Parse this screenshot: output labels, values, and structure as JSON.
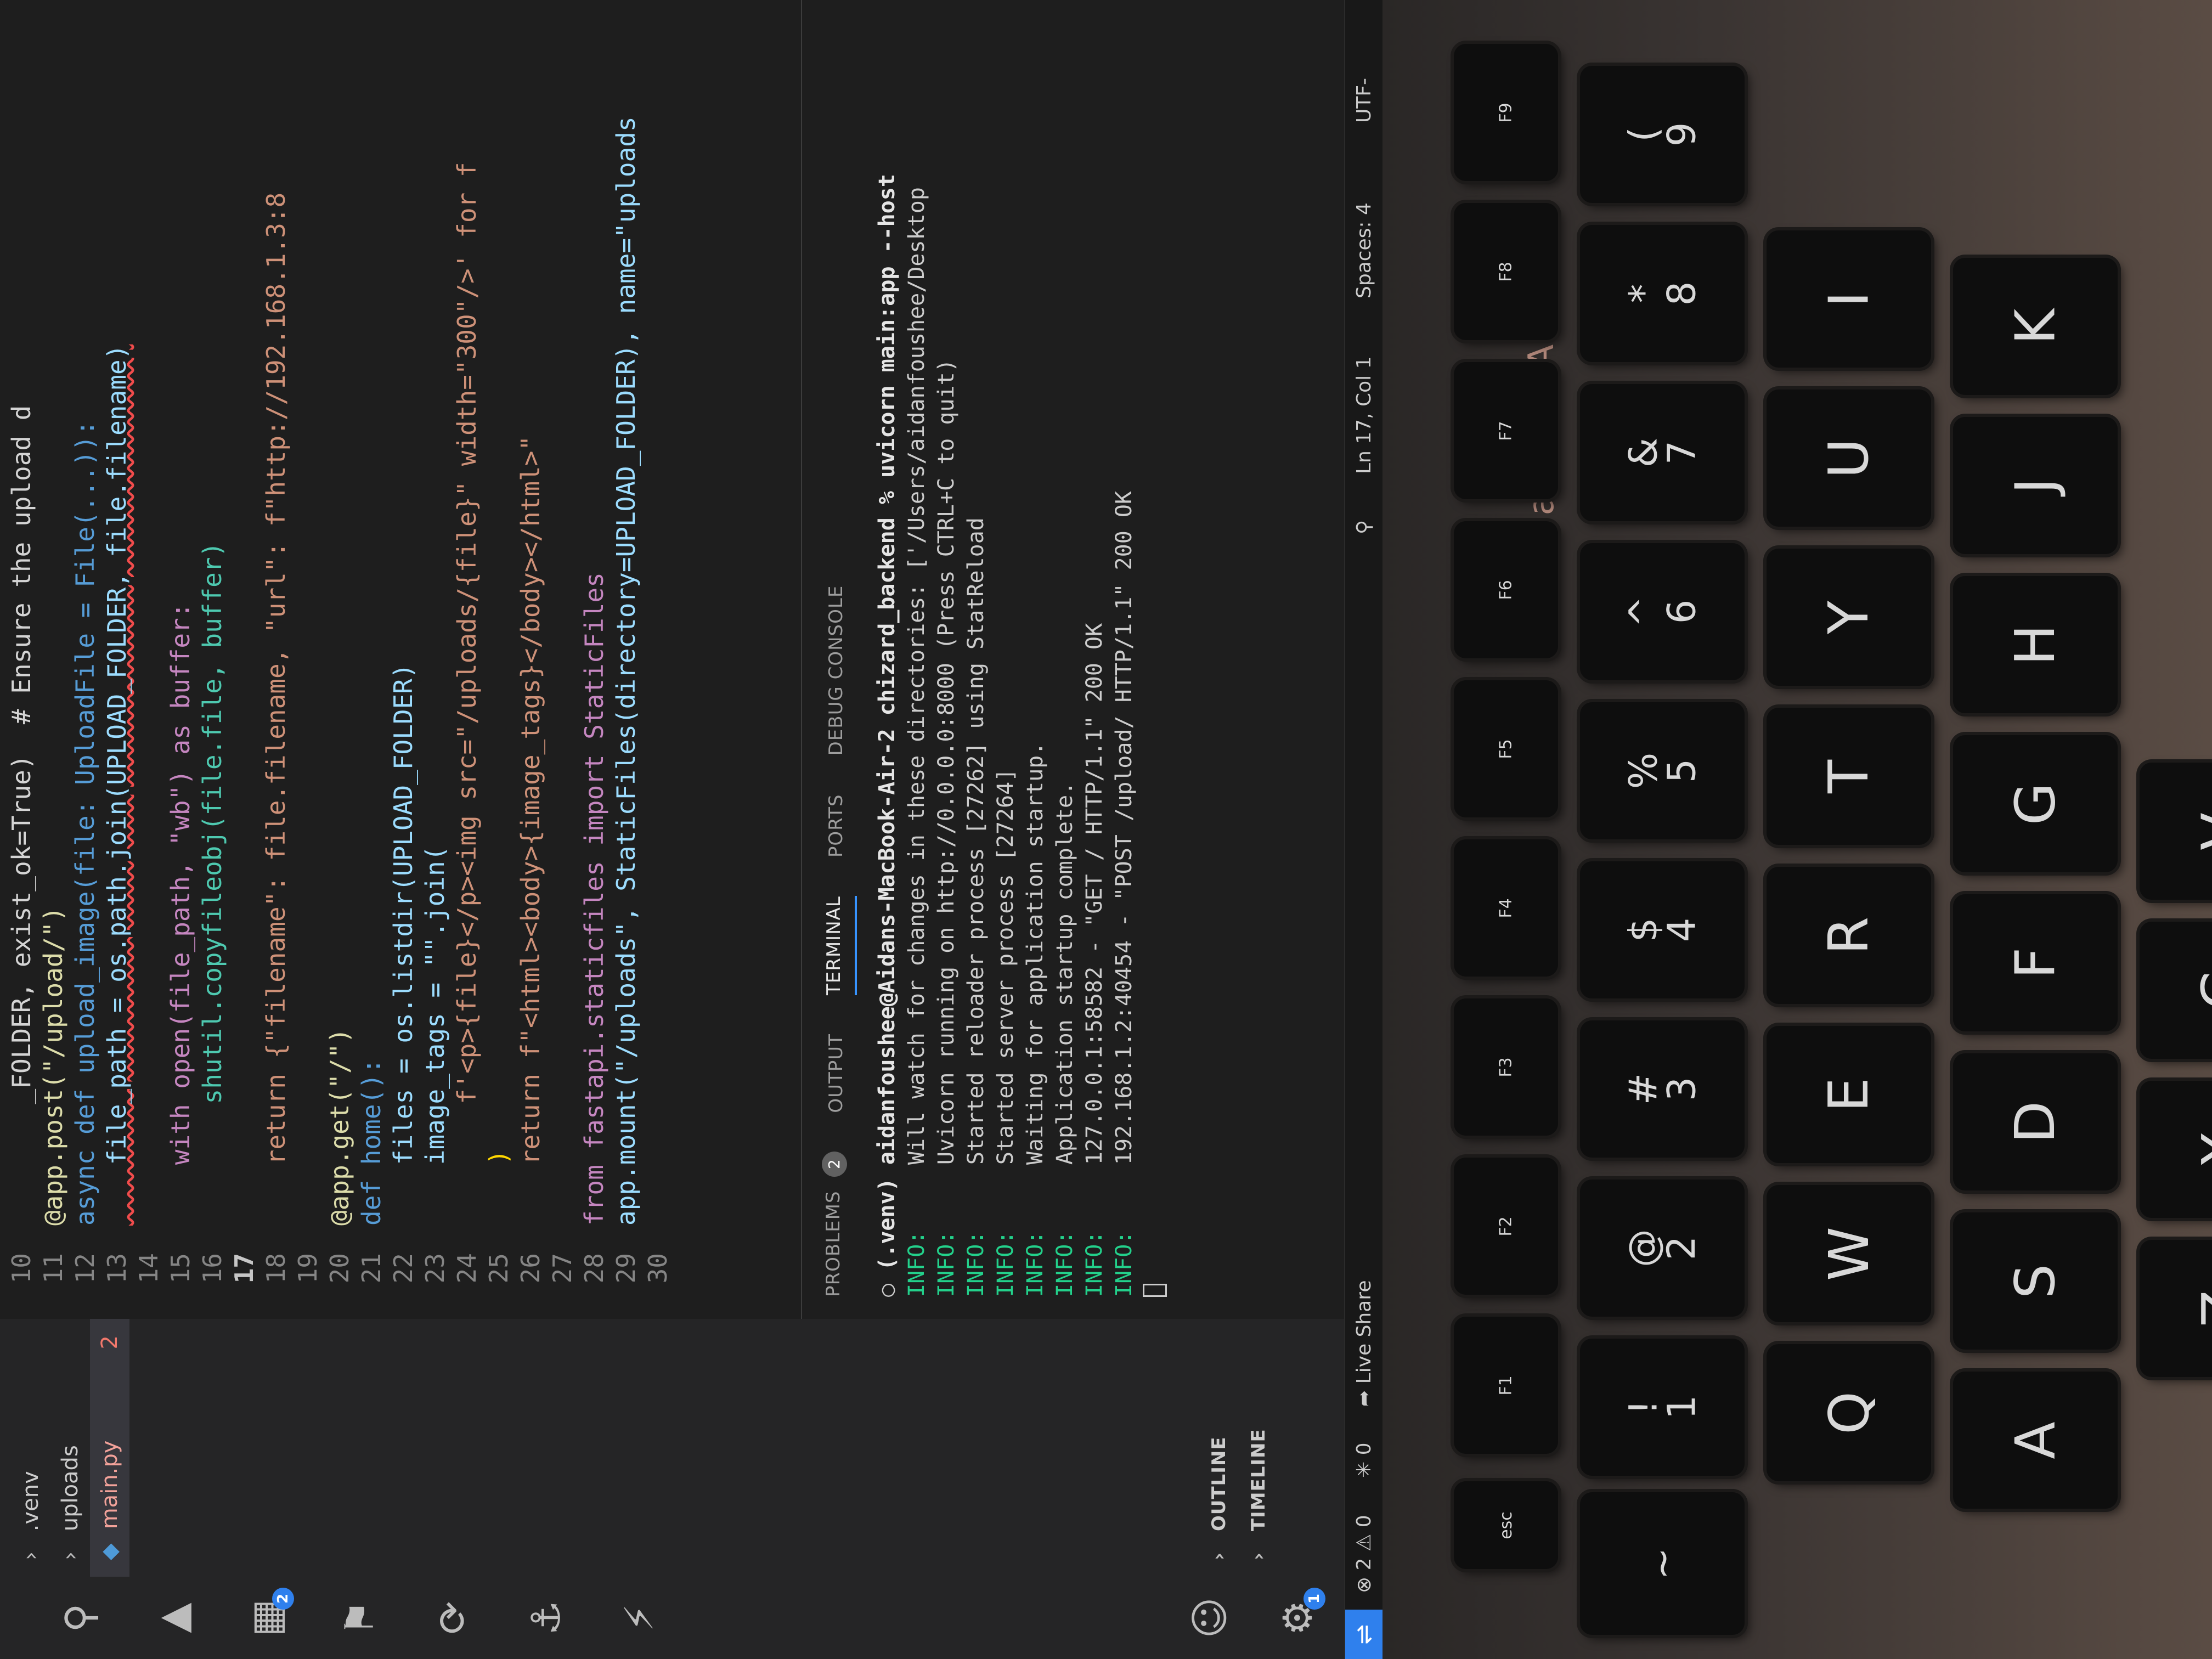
{
  "explorer": {
    "items": [
      {
        "label": ".venv"
      },
      {
        "label": "uploads"
      },
      {
        "label": "main.py",
        "problems": "2"
      }
    ],
    "panels": [
      {
        "label": "OUTLINE"
      },
      {
        "label": "TIMELINE"
      }
    ]
  },
  "activity_bar": {
    "icons": [
      "search-icon",
      "debug-icon",
      "extensions-icon",
      "testing-icon",
      "source-control-icon",
      "docker-icon",
      "lightning-icon",
      "account-icon",
      "settings-gear-icon"
    ],
    "extensions_badge": "2",
    "settings_badge": "1"
  },
  "editor": {
    "file": "main.py",
    "current_line": "17",
    "lines": [
      {
        "n": "10",
        "text": "        _FOLDER, exist_ok=True)  # Ensure the upload d"
      },
      {
        "n": "11",
        "text": "@app.post(\"/upload/\")"
      },
      {
        "n": "12",
        "text": "async def upload_image(file: UploadFile = File(...)):"
      },
      {
        "n": "13",
        "text": "    file_path = os.path.join(UPLOAD_FOLDER, file.filename)"
      },
      {
        "n": "14",
        "text": ""
      },
      {
        "n": "15",
        "text": "    with open(file_path, \"wb\") as buffer:"
      },
      {
        "n": "16",
        "text": "        shutil.copyfileobj(file.file, buffer)"
      },
      {
        "n": "17",
        "text": ""
      },
      {
        "n": "18",
        "text": "    return {\"filename\": file.filename, \"url\": f\"http://192.168.1.3:8"
      },
      {
        "n": "19",
        "text": ""
      },
      {
        "n": "20",
        "text": "@app.get(\"/\")"
      },
      {
        "n": "21",
        "text": "def home():"
      },
      {
        "n": "22",
        "text": "    files = os.listdir(UPLOAD_FOLDER)"
      },
      {
        "n": "23",
        "text": "    image_tags = \"\".join("
      },
      {
        "n": "24",
        "text": "        f'<p>{file}</p><img src=\"/uploads/{file}\" width=\"300\"/>' for f"
      },
      {
        "n": "25",
        "text": "    )"
      },
      {
        "n": "26",
        "text": "    return f\"<html><body>{image_tags}</body></html>\""
      },
      {
        "n": "27",
        "text": ""
      },
      {
        "n": "28",
        "text": "from fastapi.staticfiles import StaticFiles"
      },
      {
        "n": "29",
        "text": "app.mount(\"/uploads\", StaticFiles(directory=UPLOAD_FOLDER), name=\"uploads"
      },
      {
        "n": "30",
        "text": ""
      }
    ]
  },
  "panel": {
    "tabs": [
      {
        "label": "PROBLEMS",
        "badge": "2"
      },
      {
        "label": "OUTPUT"
      },
      {
        "label": "TERMINAL"
      },
      {
        "label": "PORTS"
      },
      {
        "label": "DEBUG CONSOLE"
      }
    ],
    "active_tab": "TERMINAL",
    "terminal": {
      "prompt": "(.venv) aidanfoushee@Aidans-MacBook-Air-2 chizard_backend % uvicorn main:app --host",
      "lines": [
        {
          "level": "INFO:",
          "text": "Will watch for changes in these directories: ['/Users/aidanfoushee/Desktop"
        },
        {
          "level": "INFO:",
          "text": "Uvicorn running on http://0.0.0.0:8000 (Press CTRL+C to quit)"
        },
        {
          "level": "INFO:",
          "text": "Started reloader process [27262] using StatReload"
        },
        {
          "level": "INFO:",
          "text": "Started server process [27264]"
        },
        {
          "level": "INFO:",
          "text": "Waiting for application startup."
        },
        {
          "level": "INFO:",
          "text": "Application startup complete."
        },
        {
          "level": "INFO:",
          "text": "127.0.0.1:58582 - \"GET / HTTP/1.1\" 200 OK"
        },
        {
          "level": "INFO:",
          "text": "192.168.1.2:40454 - \"POST /upload/ HTTP/1.1\" 200 OK"
        }
      ]
    }
  },
  "status_bar": {
    "errors": "2",
    "warnings": "0",
    "ports": "0",
    "live_share": "Live Share",
    "position": "Ln 17, Col 1",
    "spaces": "Spaces: 4",
    "encoding": "UTF-"
  },
  "laptop": {
    "brand_label": "MacBook Air",
    "keys": {
      "fn_row": [
        "esc",
        "F1",
        "F2",
        "F3",
        "F4",
        "F5",
        "F6",
        "F7",
        "F8",
        "F9"
      ],
      "number_row": [
        "~",
        "!\n1",
        "@\n2",
        "#\n3",
        "$\n4",
        "%\n5",
        "^\n6",
        "&\n7",
        "*\n8",
        "(\n9"
      ],
      "top_row": [
        "Q",
        "W",
        "E",
        "R",
        "T",
        "Y",
        "U",
        "I"
      ],
      "home_row": [
        "A",
        "S",
        "D",
        "F",
        "G",
        "H",
        "J",
        "K"
      ],
      "bottom_row": [
        "Z",
        "X",
        "C",
        "V"
      ]
    }
  }
}
